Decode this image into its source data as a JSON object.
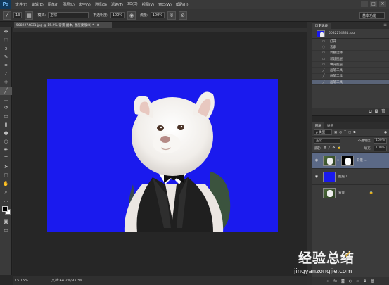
{
  "app": {
    "logo": "Ps"
  },
  "menubar": {
    "items": [
      "文件(F)",
      "编辑(E)",
      "图像(I)",
      "图层(L)",
      "文字(Y)",
      "选择(S)",
      "滤镜(T)",
      "3D(D)",
      "视图(V)",
      "窗口(W)",
      "帮助(H)"
    ],
    "window_buttons": [
      "—",
      "□",
      "✕"
    ]
  },
  "options_bar": {
    "brush_size": "13",
    "mode_label": "模式:",
    "mode_value": "正常",
    "opacity_label": "不透明度:",
    "opacity_value": "100%",
    "flow_label": "流量:",
    "flow_value": "100%",
    "workspace": "基本功能"
  },
  "document": {
    "tab_title": "5082274831.jpg @ 15.2%(背景 副本, 图层蒙版/8) *",
    "close": "×"
  },
  "status": {
    "zoom": "15.15%",
    "doc_info": "文档:44.2M/93.3M"
  },
  "history_panel": {
    "tabs": [
      "历史记录"
    ],
    "snapshot_name": "5082274831.jpg",
    "items": [
      {
        "icon": "open-icon",
        "glyph": "▭",
        "label": "打开"
      },
      {
        "icon": "lasso-icon",
        "glyph": "◌",
        "label": "套索"
      },
      {
        "icon": "refine-icon",
        "glyph": "▭",
        "label": "调整边缘"
      },
      {
        "icon": "new-layer-icon",
        "glyph": "▭",
        "label": "新建图层"
      },
      {
        "icon": "fill-icon",
        "glyph": "▭",
        "label": "填充图层"
      },
      {
        "icon": "brush-icon",
        "glyph": "╱",
        "label": "画笔工具"
      },
      {
        "icon": "brush-icon",
        "glyph": "╱",
        "label": "画笔工具"
      },
      {
        "icon": "brush-icon",
        "glyph": "╱",
        "label": "画笔工具"
      }
    ],
    "selected_index": 7
  },
  "layers_panel": {
    "tabs": [
      "图层",
      "通道"
    ],
    "filter_label": "ρ 类型",
    "blend_mode": "正常",
    "opacity_label": "不透明度:",
    "opacity_value": "100%",
    "lock_label": "锁定:",
    "fill_label": "填充:",
    "fill_value": "100%",
    "layers": [
      {
        "name": "背景 ...",
        "thumb": "photo",
        "has_mask": true,
        "locked": false,
        "visible": true,
        "selected": true
      },
      {
        "name": "图层 1",
        "thumb": "blue",
        "has_mask": false,
        "locked": false,
        "visible": true,
        "selected": false
      },
      {
        "name": "背景",
        "thumb": "photo",
        "has_mask": false,
        "locked": true,
        "visible": false,
        "selected": false
      }
    ],
    "footer_icons": [
      "link-icon",
      "fx-icon",
      "mask-icon",
      "adjust-icon",
      "folder-icon",
      "new-layer-icon",
      "trash-icon"
    ]
  },
  "watermark": {
    "cn": "经验总结",
    "en": "jingyanzongjie.com",
    "mark": "✓"
  },
  "colors": {
    "canvas_blue": "#1a1aee",
    "selected_row": "#5b6986"
  }
}
